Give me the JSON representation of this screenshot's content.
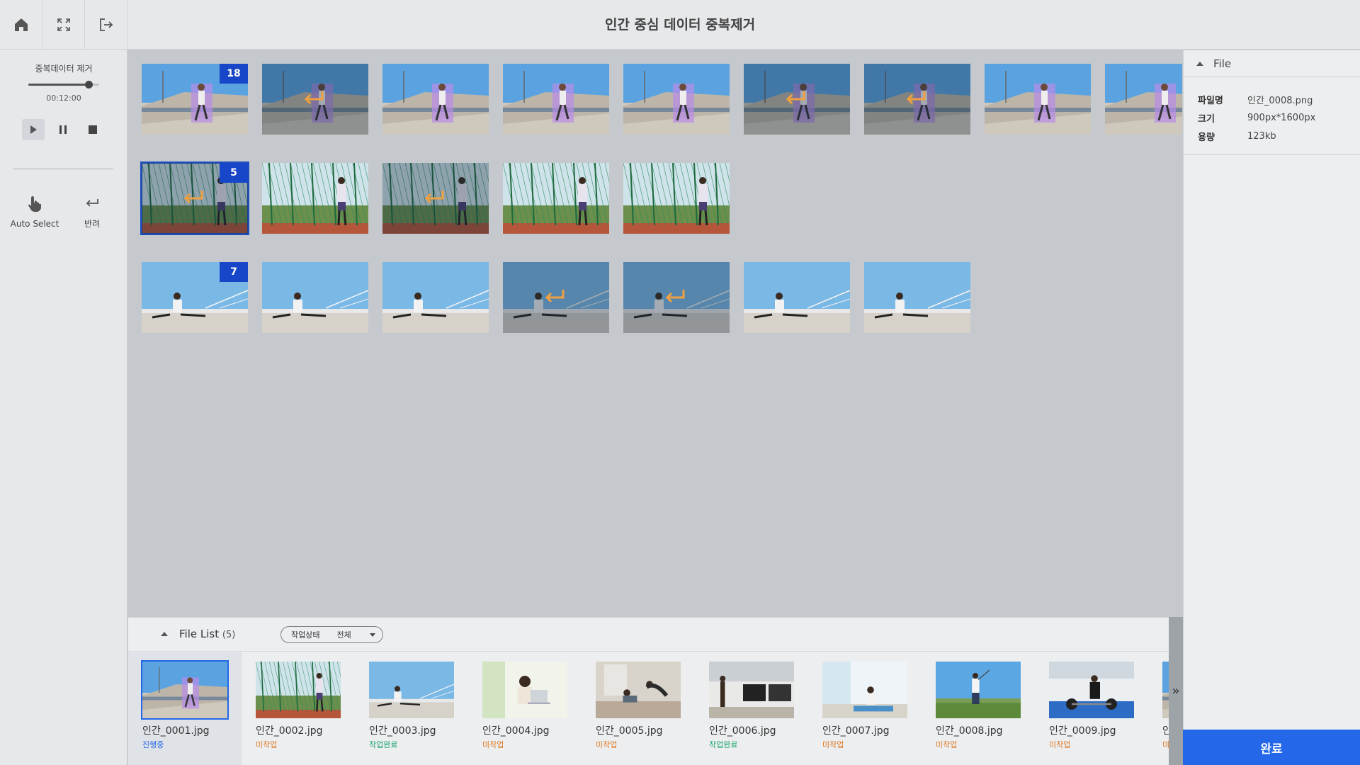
{
  "app": {
    "title": "인간 중심 데이터 중복제거"
  },
  "left_panel": {
    "title": "중복데이터 제거",
    "progress": 0.85,
    "time": "00:12:00",
    "tools": [
      {
        "label": "Auto Select"
      },
      {
        "label": "반려"
      }
    ]
  },
  "groups": [
    {
      "badge": "18",
      "scene": "runner_wall",
      "items": [
        {
          "dim": false,
          "returned": false
        },
        {
          "dim": true,
          "returned": true
        },
        {
          "dim": false,
          "returned": false
        },
        {
          "dim": false,
          "returned": false
        },
        {
          "dim": false,
          "returned": false
        },
        {
          "dim": true,
          "returned": true
        },
        {
          "dim": true,
          "returned": true
        },
        {
          "dim": false,
          "returned": false
        },
        {
          "dim": false,
          "returned": false
        }
      ]
    },
    {
      "badge": "5",
      "scene": "fence",
      "items": [
        {
          "dim": true,
          "returned": true
        },
        {
          "dim": false,
          "returned": false
        },
        {
          "dim": true,
          "returned": true
        },
        {
          "dim": false,
          "returned": false
        },
        {
          "dim": false,
          "returned": false
        }
      ]
    },
    {
      "badge": "7",
      "scene": "stretch",
      "items": [
        {
          "dim": false,
          "returned": false
        },
        {
          "dim": false,
          "returned": false
        },
        {
          "dim": false,
          "returned": false
        },
        {
          "dim": true,
          "returned": true
        },
        {
          "dim": true,
          "returned": true
        },
        {
          "dim": false,
          "returned": false
        },
        {
          "dim": false,
          "returned": false
        }
      ]
    }
  ],
  "file_panel": {
    "title": "File",
    "rows": [
      {
        "key": "파일명",
        "value": "인간_0008.png"
      },
      {
        "key": "크기",
        "value": "900px*1600px"
      },
      {
        "key": "용량",
        "value": "123kb"
      }
    ]
  },
  "done_button": "완료",
  "file_list": {
    "title": "File List",
    "count": "(5)",
    "filter_label": "작업상태",
    "filter_value": "전체",
    "files": [
      {
        "name": "인간_0001.jpg",
        "status": "진행중",
        "status_type": "progress",
        "scene": "runner_wall"
      },
      {
        "name": "인간_0002.jpg",
        "status": "미작업",
        "status_type": "todo",
        "scene": "fence"
      },
      {
        "name": "인간_0003.jpg",
        "status": "작업완료",
        "status_type": "done",
        "scene": "stretch"
      },
      {
        "name": "인간_0004.jpg",
        "status": "미작업",
        "status_type": "todo",
        "scene": "laptop"
      },
      {
        "name": "인간_0005.jpg",
        "status": "미작업",
        "status_type": "todo",
        "scene": "yoga"
      },
      {
        "name": "인간_0006.jpg",
        "status": "작업완료",
        "status_type": "done",
        "scene": "gym"
      },
      {
        "name": "인간_0007.jpg",
        "status": "미작업",
        "status_type": "todo",
        "scene": "mat"
      },
      {
        "name": "인간_0008.jpg",
        "status": "미작업",
        "status_type": "todo",
        "scene": "golf"
      },
      {
        "name": "인간_0009.jpg",
        "status": "미작업",
        "status_type": "todo",
        "scene": "weights"
      },
      {
        "name": "인",
        "status": "미",
        "status_type": "todo",
        "scene": "runner_wall"
      }
    ]
  },
  "colors": {
    "accent": "#2467e8",
    "badge": "#1846c8",
    "returned_arrow": "#f0a040"
  }
}
